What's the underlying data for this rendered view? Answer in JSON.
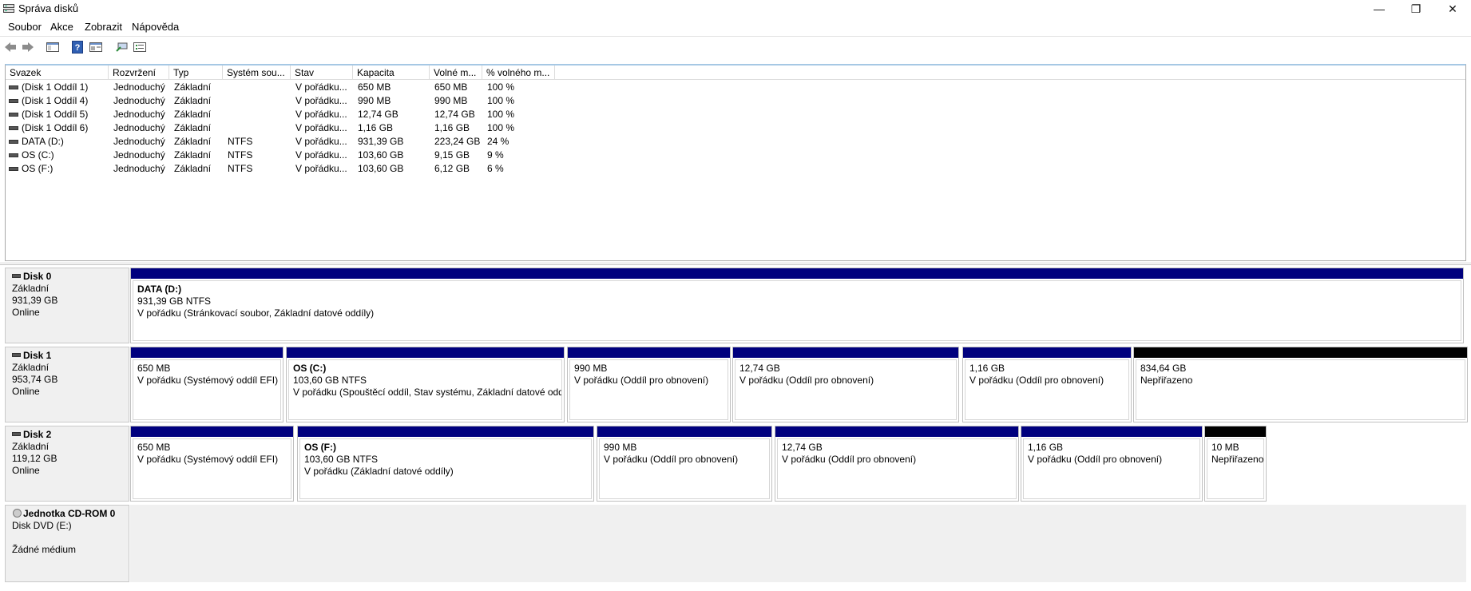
{
  "window": {
    "title": "Správa disků",
    "icon": "disk-management-icon",
    "controls": {
      "minimize": "—",
      "restore": "❐",
      "close": "✕"
    }
  },
  "menu": [
    "Soubor",
    "Akce",
    "Zobrazit",
    "Nápověda"
  ],
  "toolbar": [
    "back-arrow-icon",
    "forward-arrow-icon",
    "console-tree-icon",
    "help-icon",
    "properties-icon",
    "connect-icon",
    "list-view-icon"
  ],
  "list": {
    "columns": [
      "Svazek",
      "Rozvržení",
      "Typ",
      "Systém sou...",
      "Stav",
      "Kapacita",
      "Volné m...",
      "% volného m..."
    ],
    "rows": [
      [
        "(Disk 1 Oddíl 1)",
        "Jednoduchý",
        "Základní",
        "",
        "V pořádku...",
        "650 MB",
        "650 MB",
        "100 %"
      ],
      [
        "(Disk 1 Oddíl 4)",
        "Jednoduchý",
        "Základní",
        "",
        "V pořádku...",
        "990 MB",
        "990 MB",
        "100 %"
      ],
      [
        "(Disk 1 Oddíl 5)",
        "Jednoduchý",
        "Základní",
        "",
        "V pořádku...",
        "12,74 GB",
        "12,74 GB",
        "100 %"
      ],
      [
        "(Disk 1 Oddíl 6)",
        "Jednoduchý",
        "Základní",
        "",
        "V pořádku...",
        "1,16 GB",
        "1,16 GB",
        "100 %"
      ],
      [
        "DATA (D:)",
        "Jednoduchý",
        "Základní",
        "NTFS",
        "V pořádku...",
        "931,39 GB",
        "223,24 GB",
        "24 %"
      ],
      [
        "OS (C:)",
        "Jednoduchý",
        "Základní",
        "NTFS",
        "V pořádku...",
        "103,60 GB",
        "9,15 GB",
        "9 %"
      ],
      [
        "OS (F:)",
        "Jednoduchý",
        "Základní",
        "NTFS",
        "V pořádku...",
        "103,60 GB",
        "6,12 GB",
        "6 %"
      ]
    ]
  },
  "disks": [
    {
      "name": "Disk 0",
      "type": "Základní",
      "size": "931,39 GB",
      "status": "Online",
      "partitions": [
        {
          "name": "DATA  (D:)",
          "size": "931,39 GB NTFS",
          "status": "V pořádku (Stránkovací soubor, Základní datové oddíly)",
          "bar": "blue"
        }
      ]
    },
    {
      "name": "Disk 1",
      "type": "Základní",
      "size": "953,74 GB",
      "status": "Online",
      "partitions": [
        {
          "name": "",
          "size": "650 MB",
          "status": "V pořádku (Systémový oddíl EFI)",
          "bar": "blue"
        },
        {
          "name": "OS  (C:)",
          "size": "103,60 GB NTFS",
          "status": "V pořádku (Spouštěcí oddíl, Stav systému, Základní datové oddí",
          "bar": "blue"
        },
        {
          "name": "",
          "size": "990 MB",
          "status": "V pořádku (Oddíl pro obnovení)",
          "bar": "blue"
        },
        {
          "name": "",
          "size": "12,74 GB",
          "status": "V pořádku (Oddíl pro obnovení)",
          "bar": "blue"
        },
        {
          "name": "",
          "size": "1,16 GB",
          "status": "V pořádku (Oddíl pro obnovení)",
          "bar": "blue"
        },
        {
          "name": "",
          "size": "834,64 GB",
          "status": "Nepřiřazeno",
          "bar": "black"
        }
      ]
    },
    {
      "name": "Disk 2",
      "type": "Základní",
      "size": "119,12 GB",
      "status": "Online",
      "partitions": [
        {
          "name": "",
          "size": "650 MB",
          "status": "V pořádku (Systémový oddíl EFI)",
          "bar": "blue"
        },
        {
          "name": "OS  (F:)",
          "size": "103,60 GB NTFS",
          "status": "V pořádku (Základní datové oddíly)",
          "bar": "blue"
        },
        {
          "name": "",
          "size": "990 MB",
          "status": "V pořádku (Oddíl pro obnovení)",
          "bar": "blue"
        },
        {
          "name": "",
          "size": "12,74 GB",
          "status": "V pořádku (Oddíl pro obnovení)",
          "bar": "blue"
        },
        {
          "name": "",
          "size": "1,16 GB",
          "status": "V pořádku (Oddíl pro obnovení)",
          "bar": "blue"
        },
        {
          "name": "",
          "size": "10 MB",
          "status": "Nepřiřazeno",
          "bar": "black"
        }
      ]
    }
  ],
  "cdrom": {
    "name": "Jednotka CD-ROM 0",
    "type": "Disk DVD (E:)",
    "status": "Žádné médium"
  },
  "colors": {
    "primary_partition": "#00007e",
    "unallocated": "#000000",
    "pane_bg": "#f0f0f0"
  }
}
